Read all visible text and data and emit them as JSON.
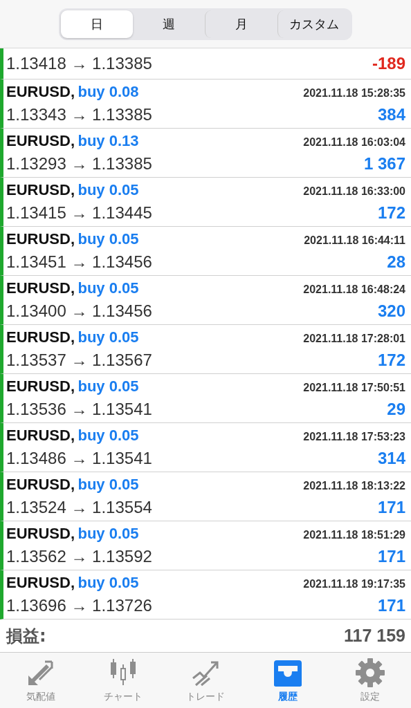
{
  "segments": [
    {
      "label": "日",
      "selected": true
    },
    {
      "label": "週",
      "selected": false
    },
    {
      "label": "月",
      "selected": false
    },
    {
      "label": "カスタム",
      "selected": false
    }
  ],
  "deals": [
    {
      "prices": "1.13418 → 1.13385",
      "profit": "-189",
      "color": "#e0281e"
    },
    {
      "symbol": "EURUSD,",
      "type": "buy 0.08",
      "time": "2021.11.18 15:28:35",
      "prices": "1.13343 → 1.13385",
      "profit": "384",
      "color": "#1a7ef0"
    },
    {
      "symbol": "EURUSD,",
      "type": "buy 0.13",
      "time": "2021.11.18 16:03:04",
      "prices": "1.13293 → 1.13385",
      "profit": "1 367",
      "color": "#1a7ef0"
    },
    {
      "symbol": "EURUSD,",
      "type": "buy 0.05",
      "time": "2021.11.18 16:33:00",
      "prices": "1.13415 → 1.13445",
      "profit": "172",
      "color": "#1a7ef0"
    },
    {
      "symbol": "EURUSD,",
      "type": "buy 0.05",
      "time": "2021.11.18 16:44:11",
      "prices": "1.13451 → 1.13456",
      "profit": "28",
      "color": "#1a7ef0"
    },
    {
      "symbol": "EURUSD,",
      "type": "buy 0.05",
      "time": "2021.11.18 16:48:24",
      "prices": "1.13400 → 1.13456",
      "profit": "320",
      "color": "#1a7ef0"
    },
    {
      "symbol": "EURUSD,",
      "type": "buy 0.05",
      "time": "2021.11.18 17:28:01",
      "prices": "1.13537 → 1.13567",
      "profit": "172",
      "color": "#1a7ef0"
    },
    {
      "symbol": "EURUSD,",
      "type": "buy 0.05",
      "time": "2021.11.18 17:50:51",
      "prices": "1.13536 → 1.13541",
      "profit": "29",
      "color": "#1a7ef0"
    },
    {
      "symbol": "EURUSD,",
      "type": "buy 0.05",
      "time": "2021.11.18 17:53:23",
      "prices": "1.13486 → 1.13541",
      "profit": "314",
      "color": "#1a7ef0"
    },
    {
      "symbol": "EURUSD,",
      "type": "buy 0.05",
      "time": "2021.11.18 18:13:22",
      "prices": "1.13524 → 1.13554",
      "profit": "171",
      "color": "#1a7ef0"
    },
    {
      "symbol": "EURUSD,",
      "type": "buy 0.05",
      "time": "2021.11.18 18:51:29",
      "prices": "1.13562 → 1.13592",
      "profit": "171",
      "color": "#1a7ef0"
    },
    {
      "symbol": "EURUSD,",
      "type": "buy 0.05",
      "time": "2021.11.18 19:17:35",
      "prices": "1.13696 → 1.13726",
      "profit": "171",
      "color": "#1a7ef0"
    }
  ],
  "summary": {
    "label": "損益:",
    "value": "117 159"
  },
  "tabbar": [
    {
      "kind": "arrows",
      "label": "気配値",
      "selected": false
    },
    {
      "kind": "candles",
      "label": "チャート",
      "selected": false
    },
    {
      "kind": "trend",
      "label": "トレード",
      "selected": false
    },
    {
      "kind": "inbox",
      "label": "履歴",
      "selected": true
    },
    {
      "kind": "gear",
      "label": "設定",
      "selected": false
    }
  ]
}
